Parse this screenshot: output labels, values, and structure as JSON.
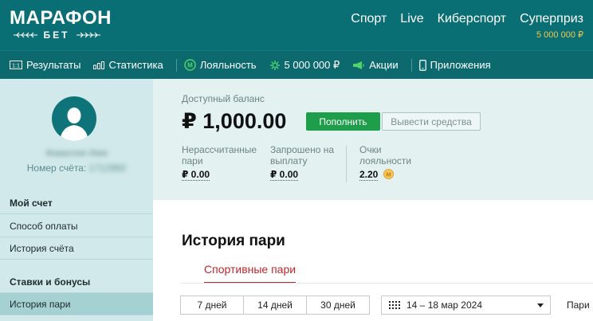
{
  "header": {
    "logo_main": "МАРАФОН",
    "logo_sub": "БЕТ",
    "nav": [
      "Спорт",
      "Live",
      "Киберспорт",
      "Суперприз"
    ],
    "superprize_amount": "5 000 000 ₽"
  },
  "subnav": {
    "items": [
      {
        "label": "Результаты",
        "icon": "results-icon"
      },
      {
        "label": "Статистика",
        "icon": "stats-icon"
      },
      {
        "label": "Лояльность",
        "icon": "loyalty-icon"
      },
      {
        "label": "5 000 000 ₽",
        "icon": "prize-icon"
      },
      {
        "label": "Акции",
        "icon": "megaphone-icon"
      },
      {
        "label": "Приложения",
        "icon": "phone-icon"
      }
    ]
  },
  "sidebar": {
    "user_name": "Фамилия Имя",
    "account_label": "Номер счёта:",
    "account_number": "1712992",
    "sections": [
      {
        "label": "Мой счет",
        "title": true
      },
      {
        "label": "Способ оплаты"
      },
      {
        "label": "История счёта"
      },
      {
        "label": "Ставки и бонусы",
        "title": true
      },
      {
        "label": "История пари",
        "active": true
      }
    ]
  },
  "balance": {
    "label": "Доступный баланс",
    "amount": "₽ 1,000.00",
    "deposit_label": "Пополнить",
    "withdraw_label": "Вывести средства",
    "stats": [
      {
        "label_line1": "Нерассчитанные",
        "label_line2": "пари",
        "value": "₽ 0.00"
      },
      {
        "label_line1": "Запрошено на",
        "label_line2": "выплату",
        "value": "₽ 0.00"
      },
      {
        "label_line1": "Очки",
        "label_line2": "лояльности",
        "value": "2.20"
      }
    ]
  },
  "history": {
    "title": "История пари",
    "tab_label": "Спортивные пари",
    "periods": [
      "7 дней",
      "14 дней",
      "30 дней"
    ],
    "date_range": "14 – 18 мар 2024",
    "trailing_label": "Пари"
  },
  "colors": {
    "header_bg": "#0a6f74",
    "accent_green": "#1e9e4a",
    "prize_yellow": "#f2c94c",
    "tab_red": "#c0272d"
  }
}
